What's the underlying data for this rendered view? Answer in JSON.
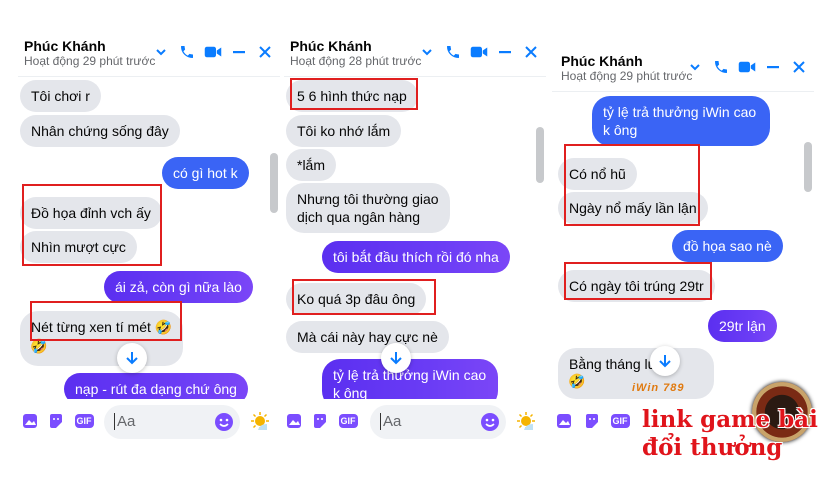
{
  "panels": [
    {
      "name": "Phúc Khánh",
      "status": "Hoạt động 29 phút trước",
      "messages": [
        "Tôi chơi r",
        "Nhân chứng sống đây",
        "có gì hot k",
        "Đồ họa đỉnh vch ấy",
        "Nhìn mượt cực",
        "ái zả, còn gì nữa lào",
        "Nét từng xen tí mét 🤣",
        "🤣",
        "nạp - rút đa dạng chứ ông"
      ],
      "placeholder": "Aa"
    },
    {
      "name": "Phúc Khánh",
      "status": "Hoạt động 28 phút trước",
      "messages": [
        "5 6 hình thức nạp",
        "Tôi ko nhớ lắm",
        "*lắm",
        "Nhưng tôi thường giao dịch qua ngân hàng",
        "tôi bắt đầu thích rồi đó nha",
        "Ko quá 3p đâu ông",
        "Mà cái này hay cực nè",
        "tỷ lệ trả thưởng iWin cao k ông"
      ],
      "placeholder": "Aa"
    },
    {
      "name": "Phúc Khánh",
      "status": "Hoạt động 29 phút trước",
      "messages": [
        "tỷ lệ trả thưởng iWin cao k ông",
        "Có nổ hũ",
        "Ngày nổ mấy lần lận",
        "đồ họa sao nè",
        "Có ngày tôi trúng 29tr",
        "29tr lận",
        "Bằng tháng lư",
        "🤣"
      ],
      "placeholder": "Aa"
    }
  ],
  "composer_icons": [
    "image-icon",
    "sticker-icon",
    "gif-icon",
    "emoji-icon",
    "reaction-icon"
  ],
  "gif_label": "GIF",
  "watermark": {
    "top": "iWin 789",
    "line1": "link game bài",
    "line2": "đổi thưởng"
  },
  "colors": {
    "accent": "#0a7cff",
    "outgoing": "#6a3cf5",
    "incoming": "#e4e6eb",
    "highlight": "#e01f1f"
  }
}
